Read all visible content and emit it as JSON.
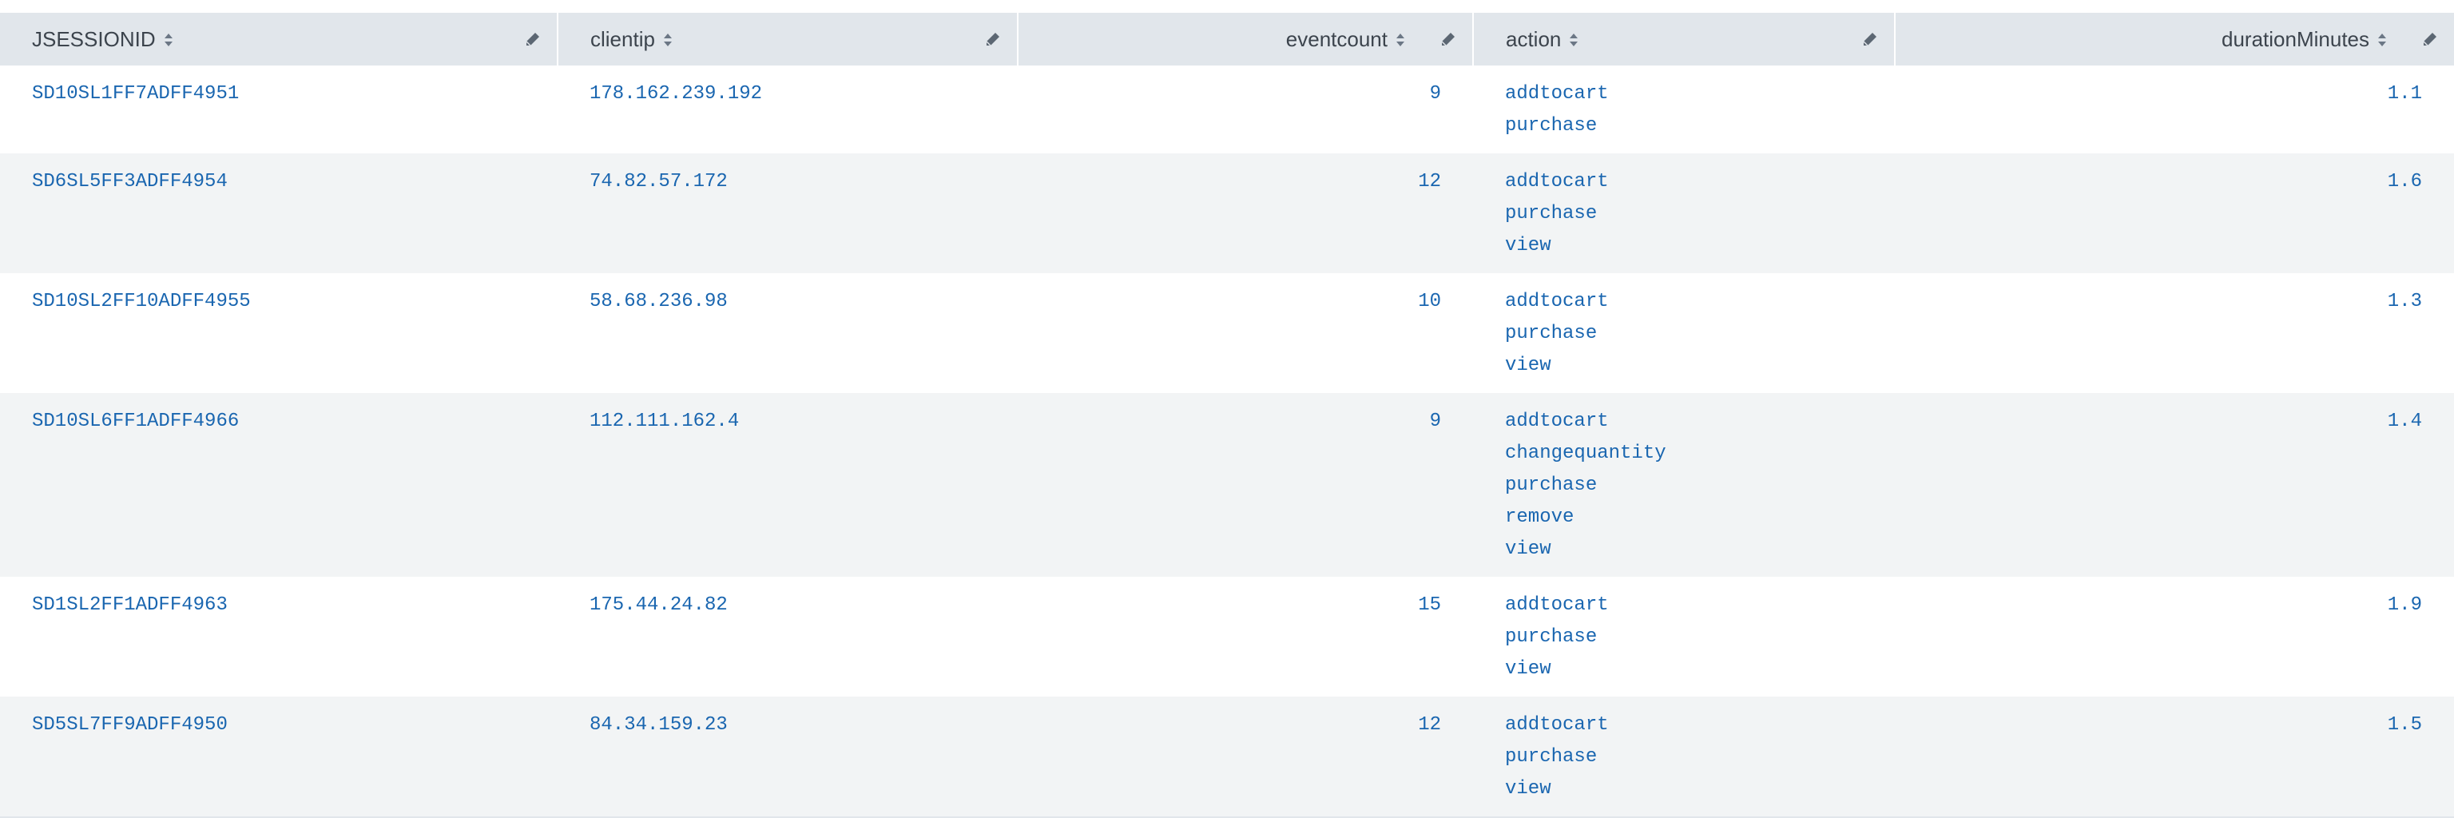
{
  "table": {
    "columns": [
      {
        "label": "JSESSIONID",
        "align": "left"
      },
      {
        "label": "clientip",
        "align": "left"
      },
      {
        "label": "eventcount",
        "align": "right"
      },
      {
        "label": "action",
        "align": "left"
      },
      {
        "label": "durationMinutes",
        "align": "right"
      }
    ],
    "rows": [
      {
        "jsessionid": "SD10SL1FF7ADFF4951",
        "clientip": "178.162.239.192",
        "eventcount": "9",
        "actions": [
          "addtocart",
          "purchase"
        ],
        "duration": "1.1"
      },
      {
        "jsessionid": "SD6SL5FF3ADFF4954",
        "clientip": "74.82.57.172",
        "eventcount": "12",
        "actions": [
          "addtocart",
          "purchase",
          "view"
        ],
        "duration": "1.6"
      },
      {
        "jsessionid": "SD10SL2FF10ADFF4955",
        "clientip": "58.68.236.98",
        "eventcount": "10",
        "actions": [
          "addtocart",
          "purchase",
          "view"
        ],
        "duration": "1.3"
      },
      {
        "jsessionid": "SD10SL6FF1ADFF4966",
        "clientip": "112.111.162.4",
        "eventcount": "9",
        "actions": [
          "addtocart",
          "changequantity",
          "purchase",
          "remove",
          "view"
        ],
        "duration": "1.4"
      },
      {
        "jsessionid": "SD1SL2FF1ADFF4963",
        "clientip": "175.44.24.82",
        "eventcount": "15",
        "actions": [
          "addtocart",
          "purchase",
          "view"
        ],
        "duration": "1.9"
      },
      {
        "jsessionid": "SD5SL7FF9ADFF4950",
        "clientip": "84.34.159.23",
        "eventcount": "12",
        "actions": [
          "addtocart",
          "purchase",
          "view"
        ],
        "duration": "1.5"
      }
    ]
  },
  "colors": {
    "header_bg": "#e1e6eb",
    "link": "#1a66b0",
    "stripe": "#f2f4f5"
  },
  "icons": {
    "sort": "sort-icon",
    "edit": "pencil-edit-icon"
  }
}
